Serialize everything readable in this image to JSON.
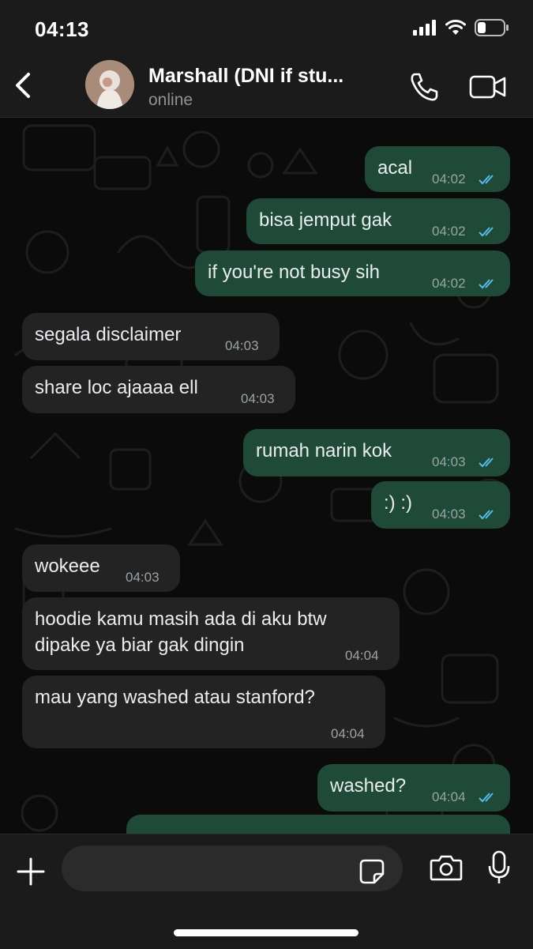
{
  "status_bar": {
    "time": "04:13"
  },
  "header": {
    "contact_name": "Marshall (DNI if stu...",
    "presence": "online"
  },
  "messages": [
    {
      "dir": "out",
      "text": "acal",
      "time": "04:02",
      "read": true
    },
    {
      "dir": "out",
      "text": "bisa jemput gak",
      "time": "04:02",
      "read": true
    },
    {
      "dir": "out",
      "text": "if you're not busy sih",
      "time": "04:02",
      "read": true
    },
    {
      "dir": "in",
      "text": "segala disclaimer",
      "time": "04:03"
    },
    {
      "dir": "in",
      "text": "share loc ajaaaa ell",
      "time": "04:03"
    },
    {
      "dir": "out",
      "text": "rumah narin kok",
      "time": "04:03",
      "read": true
    },
    {
      "dir": "out",
      "text": ":) :)",
      "time": "04:03",
      "read": true
    },
    {
      "dir": "in",
      "text": "wokeee",
      "time": "04:03"
    },
    {
      "dir": "in",
      "text": "hoodie kamu masih ada di aku btw",
      "text2": "dipake ya biar gak dingin",
      "time": "04:04"
    },
    {
      "dir": "in",
      "text": "mau yang washed atau stanford?",
      "time": "04:04"
    },
    {
      "dir": "out",
      "text": "washed?",
      "time": "04:04",
      "read": true
    }
  ],
  "composer": {
    "value": "",
    "placeholder": ""
  },
  "colors": {
    "outgoing_bubble": "#1f4a37",
    "incoming_bubble": "#232323",
    "read_tick": "#53bdeb"
  }
}
